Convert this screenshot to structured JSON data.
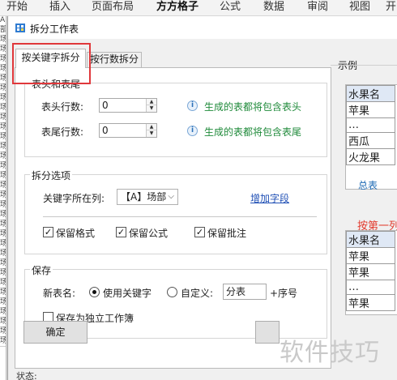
{
  "ribbon": {
    "tabs": [
      "开始",
      "插入",
      "页面布局",
      "方方格子",
      "公式",
      "数据",
      "审阅",
      "视图",
      "开"
    ],
    "active_tab": "方方格子"
  },
  "sheet": {
    "cells": [
      "A",
      "部",
      "场",
      "场",
      "场",
      "场",
      "场",
      "场",
      "场",
      "场",
      "场",
      "场",
      "场",
      "场",
      "场",
      "场",
      "场",
      "场",
      "场",
      "场",
      "场",
      "场",
      "场",
      "场",
      "场",
      "场",
      "场",
      "场",
      "场",
      "场",
      "场",
      "场",
      "场",
      "场"
    ]
  },
  "dialog": {
    "title": "拆分工作表",
    "tabs": {
      "by_keyword": "按关键字拆分",
      "by_rows": "按行数拆分"
    },
    "header_footer": {
      "group_title": "表头和表尾",
      "header_label": "表头行数:",
      "header_value": "0",
      "header_hint": "生成的表都将包含表头",
      "footer_label": "表尾行数:",
      "footer_value": "0",
      "footer_hint": "生成的表都将包含表尾"
    },
    "split_options": {
      "group_title": "拆分选项",
      "key_column_label": "关键字所在列:",
      "key_column_value": "【A】场部",
      "add_field_link": "增加字段",
      "keep_format": {
        "label": "保留格式",
        "checked": true
      },
      "keep_formula": {
        "label": "保留公式",
        "checked": true
      },
      "keep_comments": {
        "label": "保留批注",
        "checked": true
      }
    },
    "save": {
      "group_title": "保存",
      "new_name_label": "新表名:",
      "use_keyword": {
        "label": "使用关键字",
        "selected": true
      },
      "custom": {
        "label": "自定义:",
        "selected": false
      },
      "custom_value": "分表",
      "suffix_label": "+序号",
      "separate_workbook": {
        "label": "保存为独立工作簿",
        "checked": false
      }
    },
    "ok_button": "确定",
    "status_label": "状态:",
    "example": {
      "label": "示例",
      "table1": [
        "水果名",
        "苹果",
        "…",
        "西瓜",
        "火龙果"
      ],
      "sheet_tab": "总表",
      "split_note": "按第一列",
      "table2": [
        "水果名",
        "苹果",
        "苹果",
        "…",
        "苹果"
      ]
    }
  },
  "watermark": "软件技巧"
}
